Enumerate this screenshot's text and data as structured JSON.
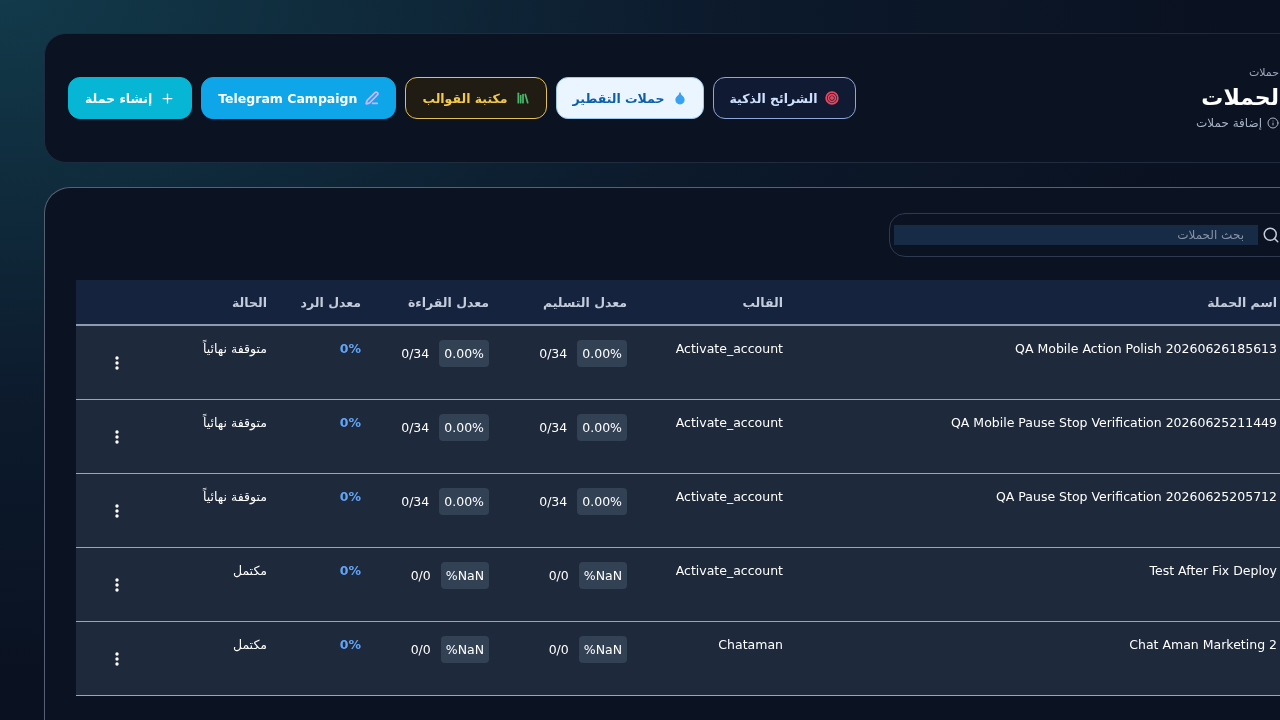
{
  "header": {
    "breadcrumb": "حملات",
    "title": "لحملات",
    "subtitle": "إضافة حملات",
    "buttons": [
      {
        "label": "الشرائح الذكية",
        "kind": "segments"
      },
      {
        "label": "حملات التقطير",
        "kind": "drip"
      },
      {
        "label": "مكتبة القوالب",
        "kind": "library"
      },
      {
        "label": "Telegram Campaign",
        "kind": "telegram"
      },
      {
        "label": "إنشاء حملة",
        "kind": "create"
      }
    ]
  },
  "search": {
    "placeholder": "بحث الحملات"
  },
  "table": {
    "columns": [
      "اسم الحملة",
      "القالب",
      "معدل التسليم",
      "معدل القراءة",
      "معدل الرد",
      "الحالة"
    ],
    "rows": [
      {
        "name": "QA Mobile Action Polish 20260626185613",
        "template": "Activate_account",
        "delivery_rate": "0.00%",
        "delivery_count": "0/34",
        "read_rate": "0.00%",
        "read_count": "0/34",
        "reply_rate": "0%",
        "status": "متوقفة نهائياً"
      },
      {
        "name": "QA Mobile Pause Stop Verification 20260625211449",
        "template": "Activate_account",
        "delivery_rate": "0.00%",
        "delivery_count": "0/34",
        "read_rate": "0.00%",
        "read_count": "0/34",
        "reply_rate": "0%",
        "status": "متوقفة نهائياً"
      },
      {
        "name": "QA Pause Stop Verification 20260625205712",
        "template": "Activate_account",
        "delivery_rate": "0.00%",
        "delivery_count": "0/34",
        "read_rate": "0.00%",
        "read_count": "0/34",
        "reply_rate": "0%",
        "status": "متوقفة نهائياً"
      },
      {
        "name": "Test After Fix Deploy",
        "template": "Activate_account",
        "delivery_rate": "%NaN",
        "delivery_count": "0/0",
        "read_rate": "%NaN",
        "read_count": "0/0",
        "reply_rate": "0%",
        "status": "مكتمل"
      },
      {
        "name": "Chat Aman Marketing 2",
        "template": "Chataman",
        "delivery_rate": "%NaN",
        "delivery_count": "0/0",
        "read_rate": "%NaN",
        "read_count": "0/0",
        "reply_rate": "0%",
        "status": "مكتمل"
      }
    ]
  }
}
